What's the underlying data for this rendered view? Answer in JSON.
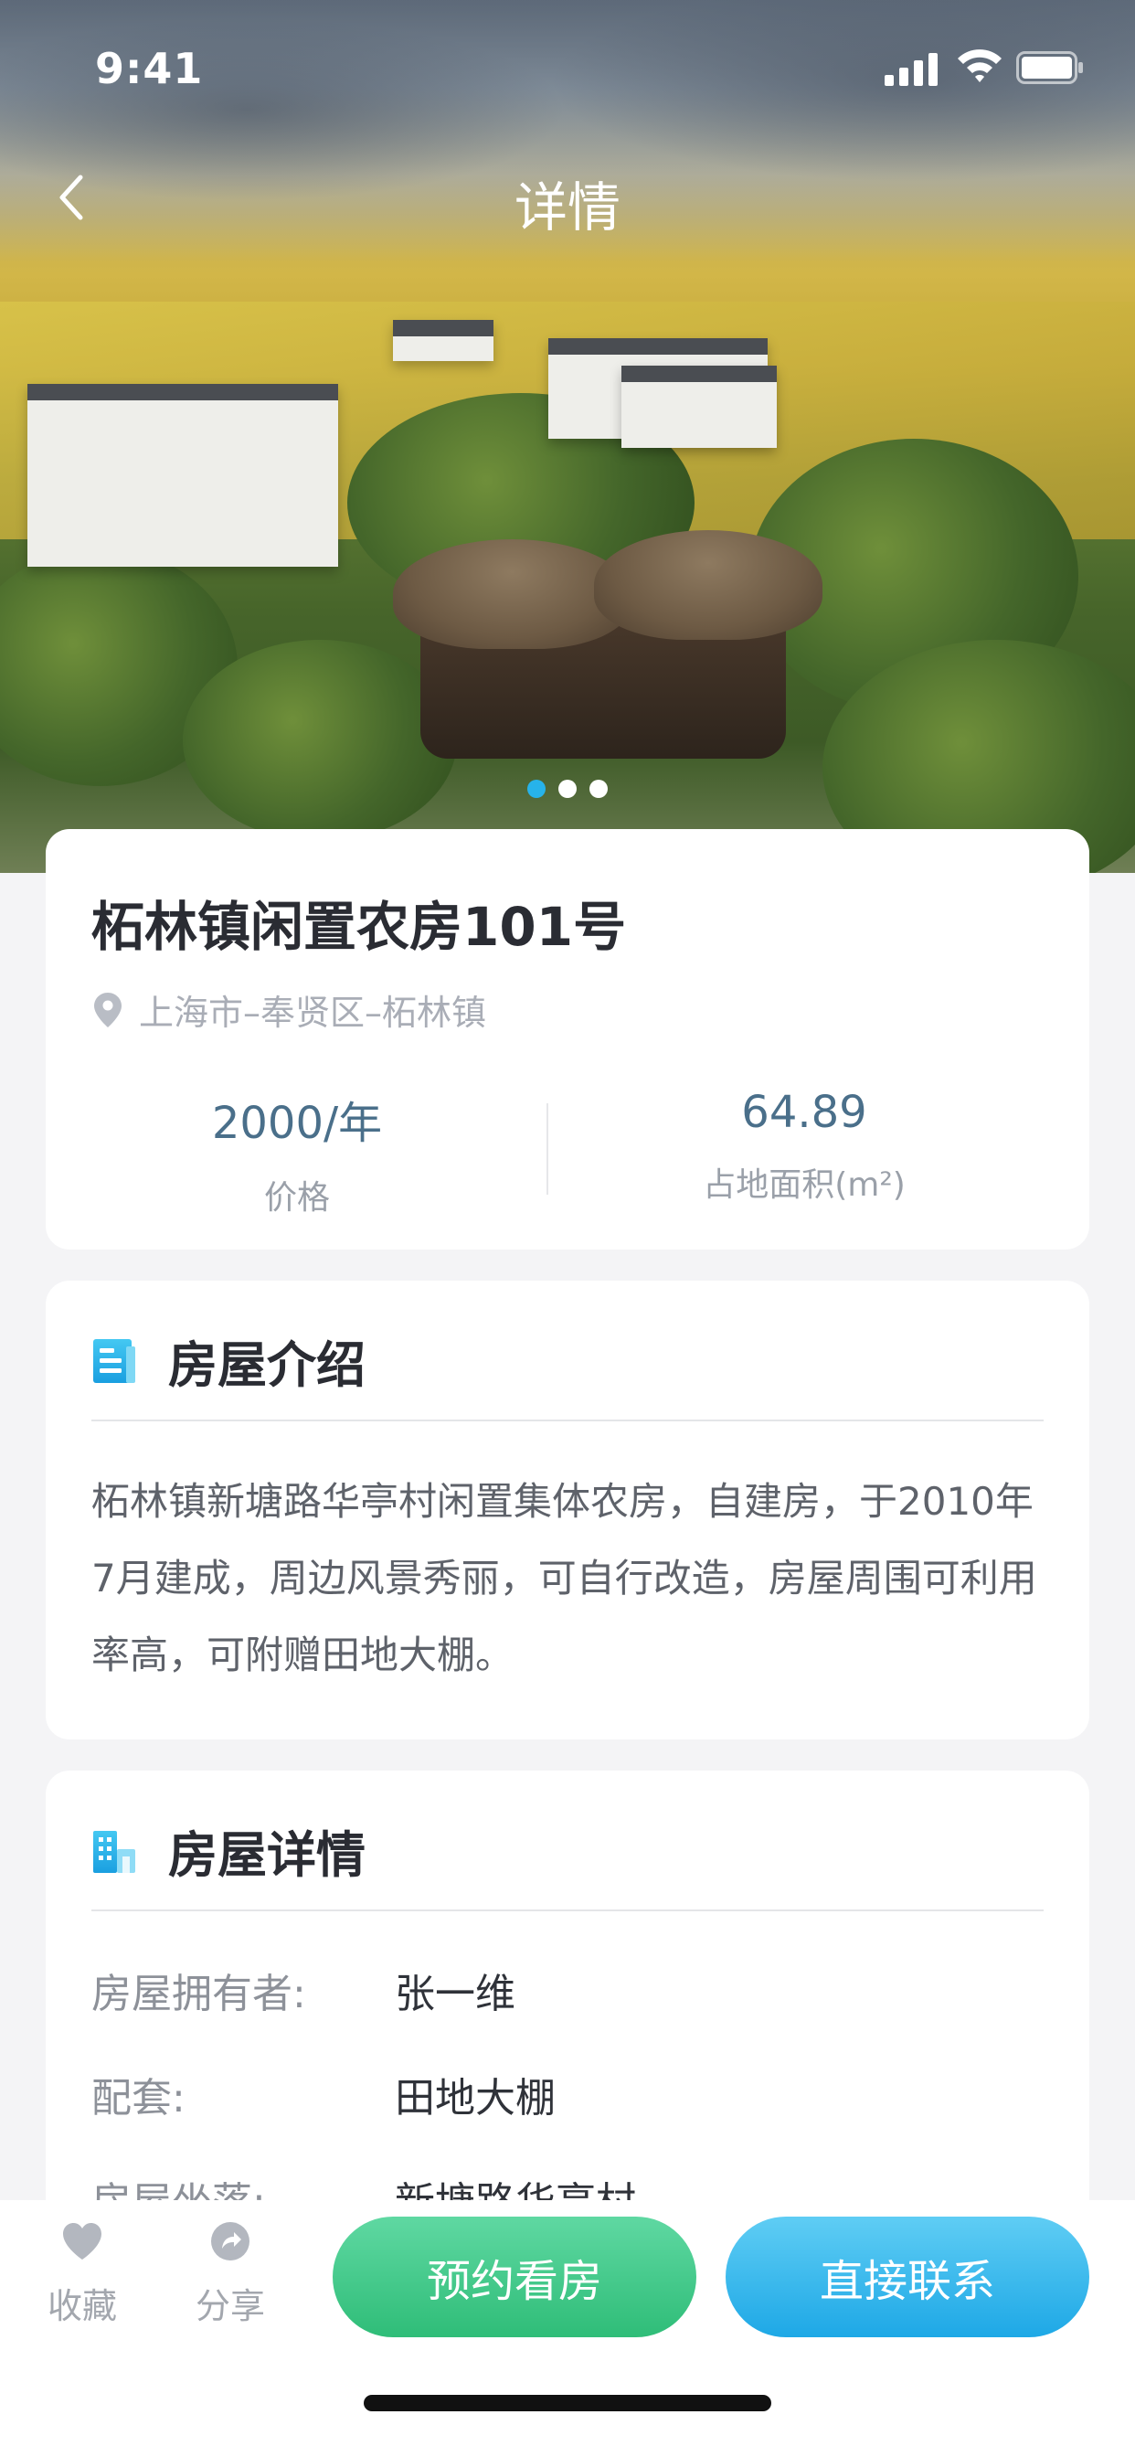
{
  "status_bar": {
    "time": "9:41"
  },
  "nav": {
    "title": "详情"
  },
  "carousel": {
    "count": 3,
    "active_index": 0
  },
  "listing": {
    "title": "柘林镇闲置农房101号",
    "address": "上海市–奉贤区–柘林镇",
    "stats": [
      {
        "value": "2000/年",
        "label": "价格"
      },
      {
        "value": "64.89",
        "label": "占地面积(m²)"
      }
    ]
  },
  "intro": {
    "title": "房屋介绍",
    "text": "柘林镇新塘路华亭村闲置集体农房，自建房，于2010年7月建成，周边风景秀丽，可自行改造，房屋周围可利用率高，可附赠田地大棚。"
  },
  "details": {
    "title": "房屋详情",
    "rows": [
      {
        "key": "房屋拥有者:",
        "value": "张一维"
      },
      {
        "key": "配套:",
        "value": "田地大棚"
      },
      {
        "key": "房屋坐落:",
        "value": "新塘路华亭村"
      }
    ]
  },
  "bottom_bar": {
    "favorite_label": "收藏",
    "share_label": "分享",
    "book_label": "预约看房",
    "contact_label": "直接联系"
  },
  "colors": {
    "accent_blue": "#27b3ea",
    "accent_green": "#2fbd78",
    "stat_value": "#4a6f8a"
  }
}
